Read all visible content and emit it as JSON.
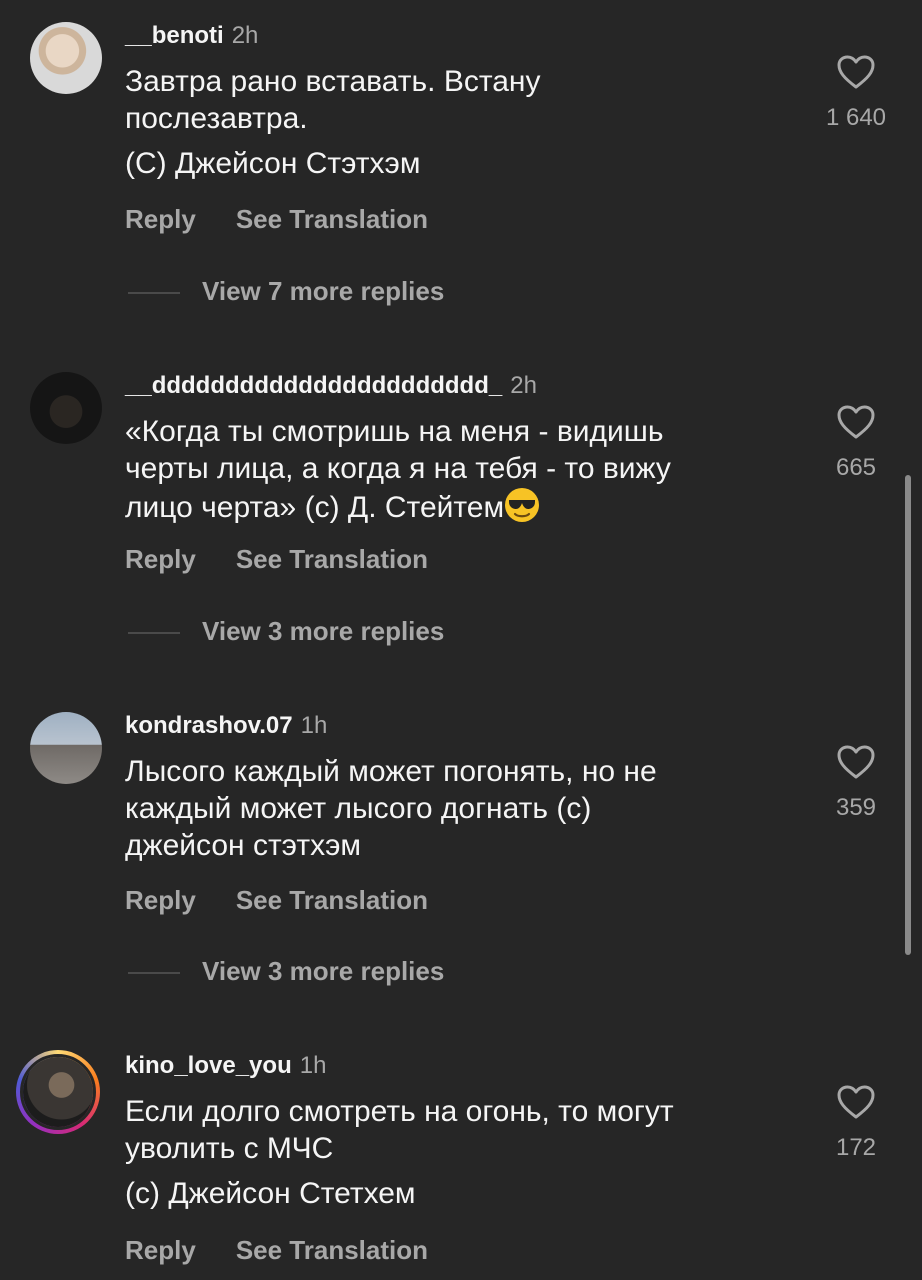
{
  "comments": [
    {
      "username": "__benoti",
      "time": "2h",
      "lines": [
        "Завтра рано вставать. Встану",
        "послезавтра.",
        "(С) Джейсон Стэтхэм"
      ],
      "likes": "1 640",
      "reply_label": "Reply",
      "translate_label": "See Translation",
      "more_replies": "View 7 more replies"
    },
    {
      "username": "__ddddddddddddddddddddddd_",
      "time": "2h",
      "lines": [
        "«Когда ты смотришь на меня - видишь",
        "черты лица, а когда я на тебя - то вижу",
        "лицо черта» (с) Д. Стейтем"
      ],
      "emoji": "smiling-face-with-sunglasses",
      "likes": "665",
      "reply_label": "Reply",
      "translate_label": "See Translation",
      "more_replies": "View 3 more replies"
    },
    {
      "username": "kondrashov.07",
      "time": "1h",
      "lines": [
        "Лысого каждый может погонять, но не",
        "каждый может лысого догнать (с)",
        "джейсон стэтхэм"
      ],
      "likes": "359",
      "reply_label": "Reply",
      "translate_label": "See Translation",
      "more_replies": "View 3 more replies"
    },
    {
      "username": "kino_love_you",
      "time": "1h",
      "lines": [
        "Если долго смотреть на огонь, то могут",
        "уволить с МЧС",
        "(с) Джейсон Стетхем"
      ],
      "likes": "172",
      "reply_label": "Reply",
      "translate_label": "See Translation"
    }
  ],
  "icons": {
    "like": "heart-outline-icon"
  },
  "colors": {
    "background": "#262626",
    "text": "#f5f5f5",
    "secondary": "#a8a8a8"
  }
}
